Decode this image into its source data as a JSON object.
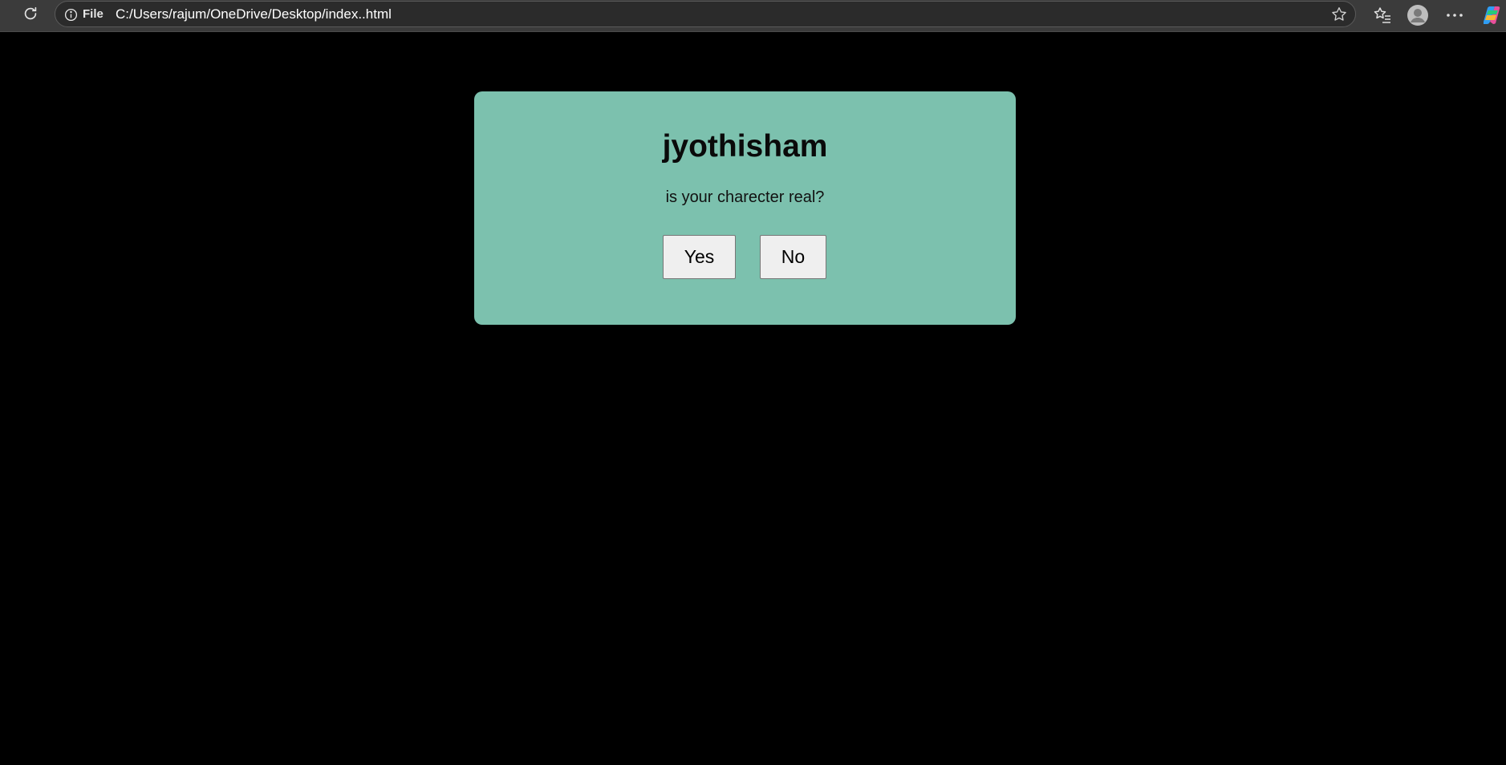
{
  "browser": {
    "scheme_label": "File",
    "url": "C:/Users/rajum/OneDrive/Desktop/index..html",
    "icons": {
      "reload": "reload-icon",
      "info": "info-icon",
      "favorite": "star-icon",
      "favorites_list": "favorites-icon",
      "profile": "profile-avatar-icon",
      "more": "more-options-icon",
      "copilot": "copilot-icon"
    },
    "colors": {
      "toolbar": "#3b3b3b",
      "address_bar": "#2b2b2b"
    }
  },
  "page": {
    "background": "#000000",
    "card": {
      "title": "jyothisham",
      "question": "is your charecter real?",
      "yes_label": "Yes",
      "no_label": "No",
      "background": "#7cc1ae"
    }
  }
}
